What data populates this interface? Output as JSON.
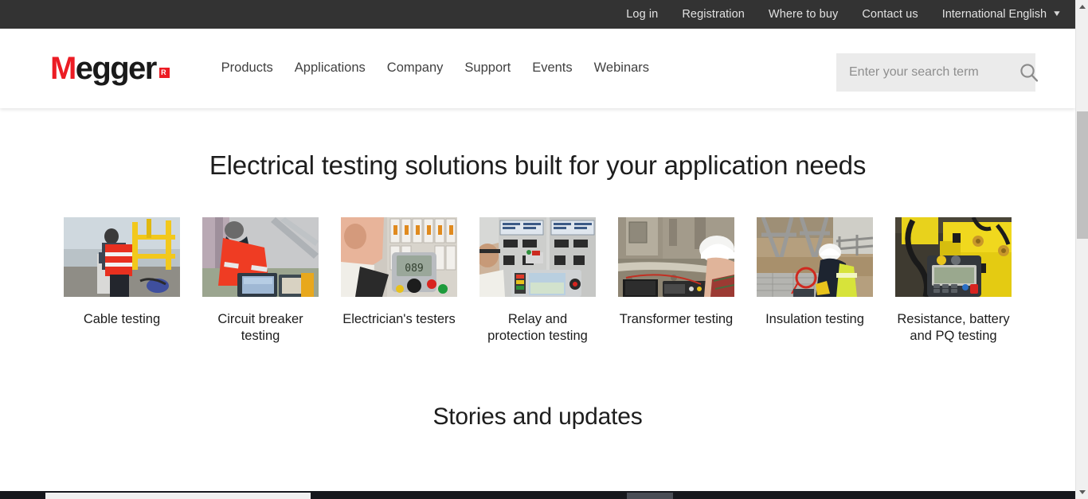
{
  "utility_bar": {
    "links": [
      {
        "label": "Log in"
      },
      {
        "label": "Registration"
      },
      {
        "label": "Where to buy"
      },
      {
        "label": "Contact us"
      }
    ],
    "language": {
      "label": "International English",
      "caret": "▼"
    },
    "background_color": "#333333",
    "text_color": "#e2e2e2"
  },
  "header": {
    "logo": {
      "initial": "M",
      "rest": "egger",
      "mark": "R",
      "initial_color": "#ec1c24",
      "rest_color": "#1a1a1a"
    },
    "nav": [
      {
        "label": "Products"
      },
      {
        "label": "Applications"
      },
      {
        "label": "Company"
      },
      {
        "label": "Support"
      },
      {
        "label": "Events"
      },
      {
        "label": "Webinars"
      }
    ],
    "search": {
      "placeholder": "Enter your search term",
      "value": "",
      "icon": "search-icon",
      "background_color": "#ebebeb"
    }
  },
  "main": {
    "hero_title": "Electrical testing solutions built for your application needs",
    "categories": [
      {
        "label": "Cable testing",
        "image": "worker-in-red-vest-at-offshore-platform-with-yellow-railings"
      },
      {
        "label": "Circuit breaker testing",
        "image": "engineer-in-red-hi-vis-jacket-operating-test-set-at-substation"
      },
      {
        "label": "Electrician's testers",
        "image": "technician-holding-handheld-multifunction-tester-at-consumer-unit"
      },
      {
        "label": "Relay and protection testing",
        "image": "engineer-using-relay-test-set-in-front-of-protection-panels"
      },
      {
        "label": "Transformer testing",
        "image": "engineer-in-white-hard-hat-testing-transformer-with-test-set-on-gravel"
      },
      {
        "label": "Insulation testing",
        "image": "worker-in-yellow-hi-vis-kneeling-on-grating-near-pylon"
      },
      {
        "label": "Resistance, battery and PQ testing",
        "image": "handheld-tester-connected-to-yellow-battery-bank"
      }
    ],
    "section_title": "Stories and updates"
  },
  "scrollbar": {
    "up_arrow": "▲",
    "down_arrow": "▼",
    "orientation": "vertical"
  }
}
